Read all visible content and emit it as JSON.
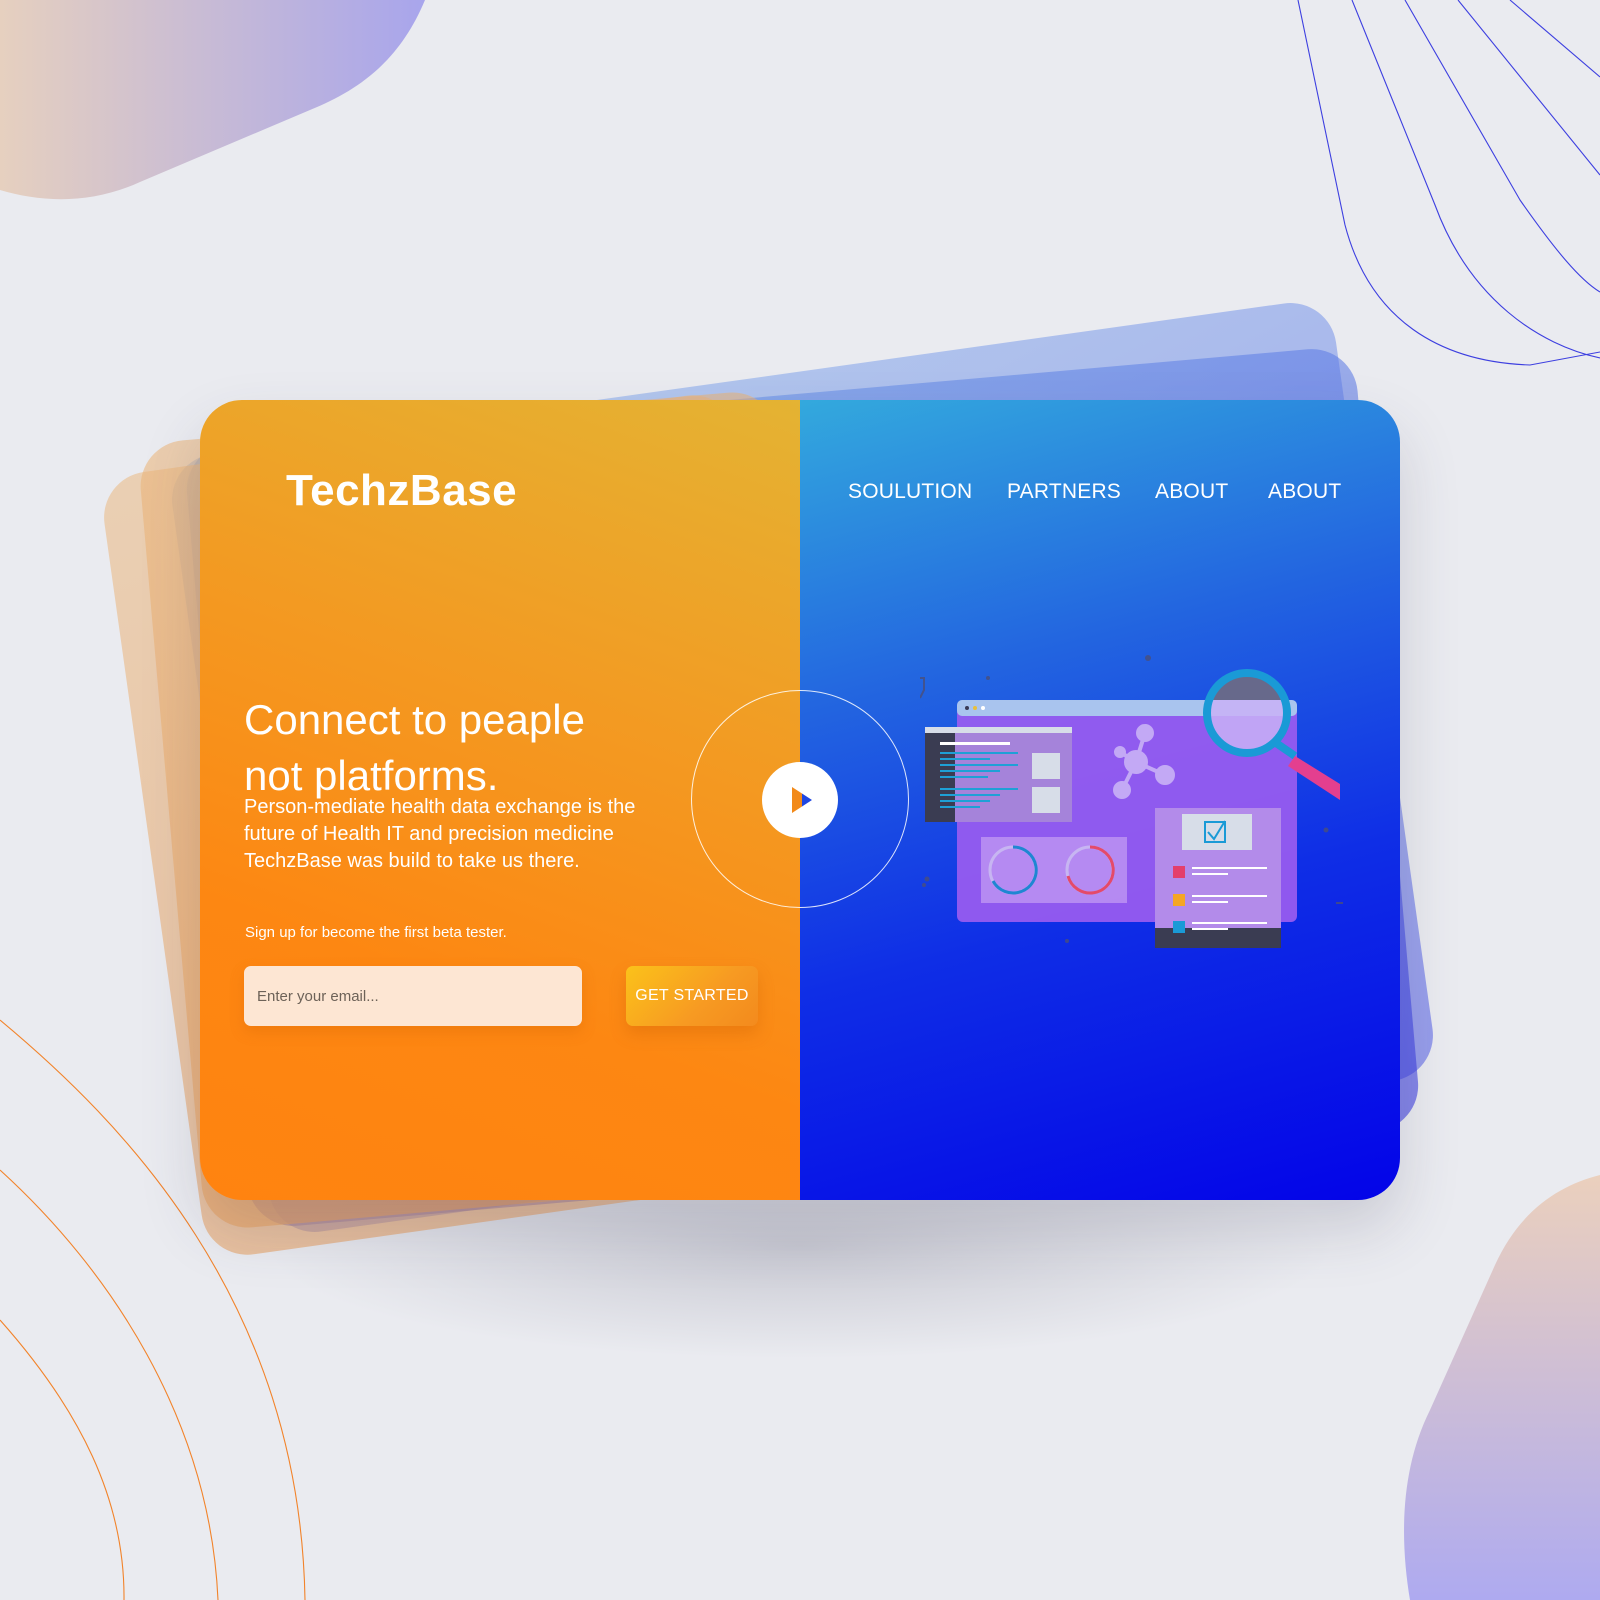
{
  "brand": {
    "logo": "TechzBase"
  },
  "nav": {
    "items": [
      {
        "label": "SOULUTION"
      },
      {
        "label": "PARTNERS"
      },
      {
        "label": "ABOUT"
      },
      {
        "label": "ABOUT"
      }
    ]
  },
  "hero": {
    "headline_line1": "Connect to peaple",
    "headline_line2": "not platforms.",
    "description": "Person-mediate health data exchange is the future of Health IT and precision medicine TechzBase was build to take us there."
  },
  "signup": {
    "label": "Sign up for become the first beta tester.",
    "email_placeholder": "Enter your email...",
    "button_label": "GET STARTED"
  },
  "colors": {
    "orange_panel": "#ff8310",
    "blue_panel": "#0303e8",
    "illustration_purple": "#9a5cf0",
    "magnifier": "#1a9ad6",
    "accent_pink": "#e43f8f"
  },
  "icons": {
    "play": "play-icon",
    "magnifier": "magnifier-icon",
    "checkbox": "checkbox-icon",
    "molecule": "molecule-icon"
  }
}
